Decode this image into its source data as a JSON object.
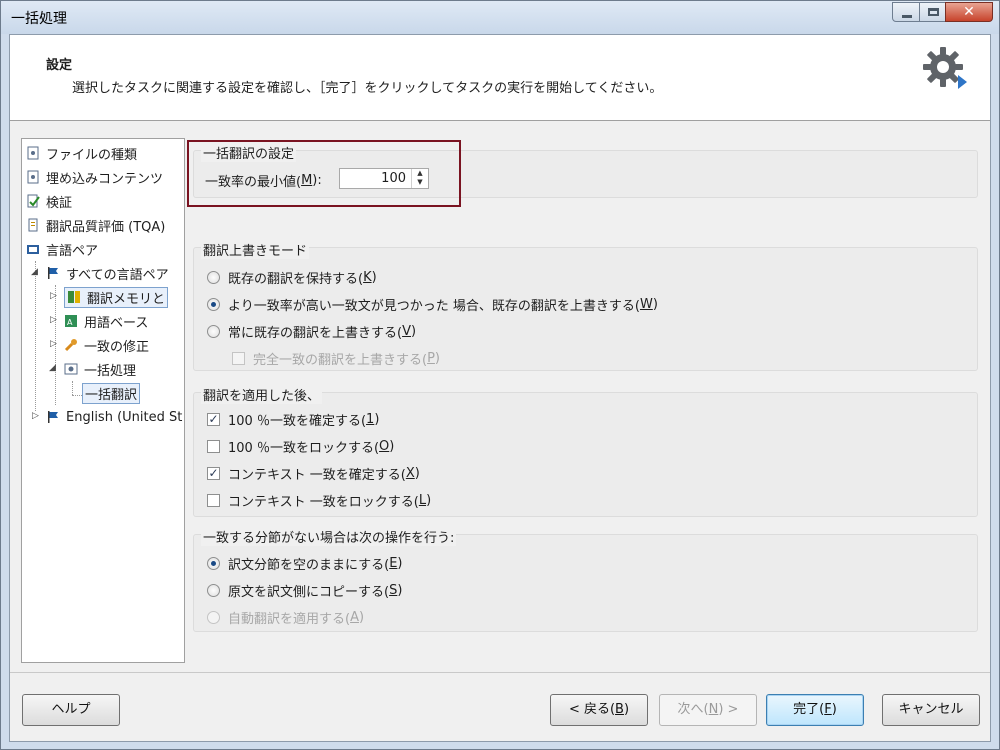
{
  "window": {
    "title": "一括処理",
    "controls": {
      "min": "minimize",
      "max": "maximize",
      "close": "close"
    }
  },
  "header": {
    "title": "設定",
    "description": "選択したタスクに関連する設定を確認し、［完了］をクリックしてタスクの実行を開始してください。",
    "icon": "settings-gear-icon"
  },
  "nav": {
    "items": [
      {
        "label": "ファイルの種類",
        "icon": "file-settings-icon"
      },
      {
        "label": "埋め込みコンテンツ",
        "icon": "embedded-content-icon"
      },
      {
        "label": "検証",
        "icon": "verification-icon"
      },
      {
        "label": "翻訳品質評価 (TQA)",
        "icon": "tqa-icon"
      },
      {
        "label": "言語ペア",
        "icon": "language-pair-icon"
      },
      {
        "label": "すべての言語ペア",
        "icon": "flag-icon"
      },
      {
        "label": "翻訳メモリと",
        "icon": "tm-icon"
      },
      {
        "label": "用語ベース",
        "icon": "termbase-icon"
      },
      {
        "label": "一致の修正",
        "icon": "wrench-icon"
      },
      {
        "label": "一括処理",
        "icon": "batch-icon"
      },
      {
        "label": "一括翻訳",
        "icon": ""
      },
      {
        "label": "English (United St",
        "icon": "flag-icon"
      }
    ]
  },
  "pretranslate": {
    "group_label": "一括翻訳の設定",
    "min_match_label": "一致率の最小値(",
    "min_match_accel": "M",
    "min_match_suffix": "):",
    "min_match_value": "100"
  },
  "overwrite": {
    "group_label": "翻訳上書きモード",
    "options": [
      {
        "label": "既存の翻訳を保持する(",
        "accel": "K",
        "suffix": ")",
        "checked": false
      },
      {
        "label": "より一致率が高い一致文が見つかった 場合、既存の翻訳を上書きする(",
        "accel": "W",
        "suffix": ")",
        "checked": true
      },
      {
        "label": "常に既存の翻訳を上書きする(",
        "accel": "V",
        "suffix": ")",
        "checked": false
      }
    ],
    "sub_option": {
      "label": "完全一致の翻訳を上書きする(",
      "accel": "P",
      "suffix": ")",
      "checked": false,
      "enabled": false
    }
  },
  "after_apply": {
    "group_label": "翻訳を適用した後、",
    "options": [
      {
        "label": "100 ％一致を確定する(",
        "accel": "1",
        "suffix": ")",
        "checked": true
      },
      {
        "label": "100 ％一致をロックする(",
        "accel": "O",
        "suffix": ")",
        "checked": false
      },
      {
        "label": "コンテキスト 一致を確定する(",
        "accel": "X",
        "suffix": ")",
        "checked": true
      },
      {
        "label": "コンテキスト 一致をロックする(",
        "accel": "L",
        "suffix": ")",
        "checked": false
      }
    ]
  },
  "no_match": {
    "group_label": "一致する分節がない場合は次の操作を行う:",
    "options": [
      {
        "label": "訳文分節を空のままにする(",
        "accel": "E",
        "suffix": ")",
        "checked": true
      },
      {
        "label": "原文を訳文側にコピーする(",
        "accel": "S",
        "suffix": ")",
        "checked": false
      },
      {
        "label": "自動翻訳を適用する(",
        "accel": "A",
        "suffix": ")",
        "checked": false
      }
    ]
  },
  "footer": {
    "help": "ヘルプ",
    "back": "< 戻る(",
    "back_accel": "B",
    "back_suffix": ")",
    "next": "次へ(",
    "next_accel": "N",
    "next_suffix": ") >",
    "finish": "完了(",
    "finish_accel": "F",
    "finish_suffix": ")",
    "cancel": "キャンセル"
  },
  "colors": {
    "highlight": "#7a1321",
    "accent": "#3c7fb1"
  }
}
